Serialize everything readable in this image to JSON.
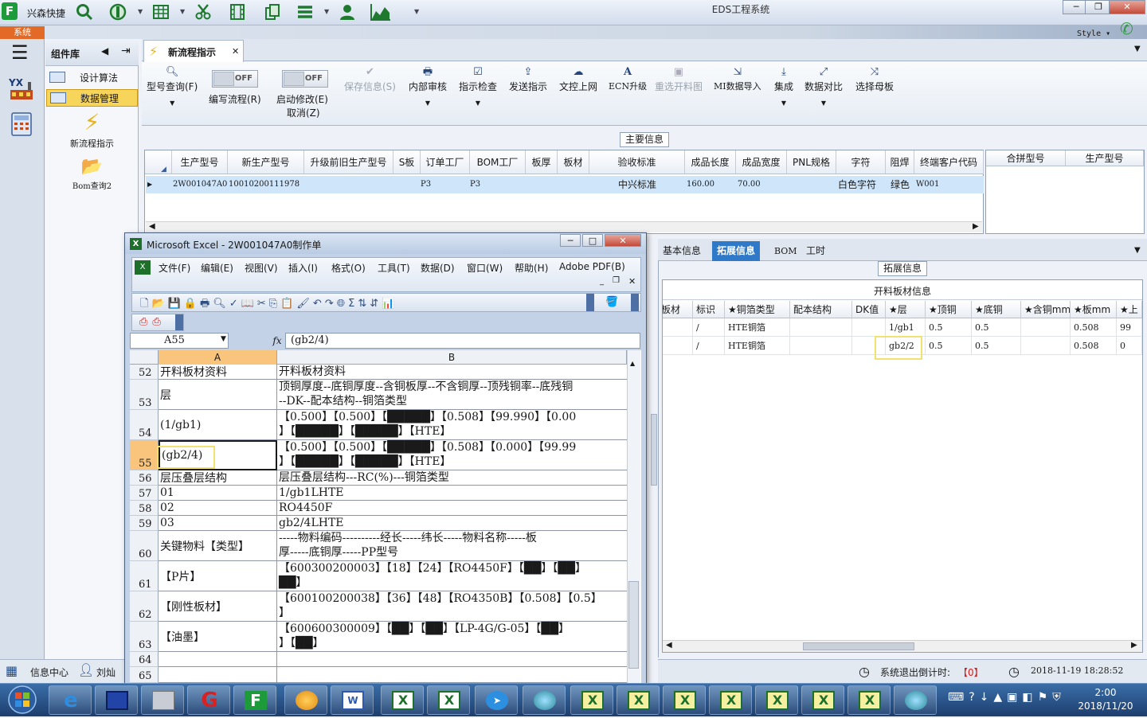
{
  "app": {
    "name": "兴森快捷",
    "window_title": "EDS工程系统",
    "system_tab": "系统",
    "style_label": "Style"
  },
  "library": {
    "title": "组件库",
    "items": [
      "设计算法",
      "数据管理"
    ],
    "big_items": [
      "新流程指示",
      "Bom查询2"
    ]
  },
  "document_tab": "新流程指示",
  "ribbon": {
    "buttons": [
      {
        "label": "型号查询(F)",
        "disabled": false
      },
      {
        "label": "编写流程(R)",
        "disabled": false,
        "toggle": "OFF"
      },
      {
        "label": "启动修改(E)",
        "sub": "取消(Z)",
        "disabled": false,
        "toggle": "OFF"
      },
      {
        "label": "保存信息(S)",
        "disabled": true
      },
      {
        "label": "内部审核",
        "disabled": false
      },
      {
        "label": "指示检查",
        "disabled": false
      },
      {
        "label": "发送指示",
        "disabled": false
      },
      {
        "label": "文控上网",
        "disabled": false
      },
      {
        "label": "ECN升级",
        "disabled": false
      },
      {
        "label": "重选开料图",
        "disabled": true
      },
      {
        "label": "MI数据导入",
        "disabled": false
      },
      {
        "label": "集成",
        "disabled": false
      },
      {
        "label": "数据对比",
        "disabled": false
      },
      {
        "label": "选择母板",
        "disabled": false
      }
    ]
  },
  "main_info": {
    "caption": "主要信息",
    "columns": [
      "生产型号",
      "新生产型号",
      "升级前旧生产型号",
      "S板",
      "订单工厂",
      "BOM工厂",
      "板厚",
      "板材",
      "验收标准",
      "成品长度",
      "成品宽度",
      "PNL规格",
      "字符",
      "阻焊",
      "终端客户代码"
    ],
    "row": [
      "2W001047A0",
      "10010200111978",
      "",
      "",
      "P3",
      "P3",
      "",
      "",
      "中兴标准",
      "160.00",
      "70.00",
      "",
      "白色字符",
      "绿色",
      "W001"
    ],
    "side_columns": [
      "合拼型号",
      "生产型号"
    ]
  },
  "right_panel": {
    "tabs": [
      "基本信息",
      "拓展信息",
      "BOM",
      "工时"
    ],
    "active_tab": "拓展信息",
    "caption": "拓展信息",
    "grid_title": "开料板材信息",
    "columns": [
      "板材",
      "标识",
      "★铜箔类型",
      "配本结构",
      "DK值",
      "★层",
      "★顶铜",
      "★底铜",
      "★含铜mm",
      "★板mm",
      "★上"
    ],
    "rows": [
      [
        "",
        "/",
        "HTE铜箔",
        "",
        "",
        "1/gb1",
        "0.5",
        "0.5",
        "",
        "0.508",
        "99"
      ],
      [
        "",
        "/",
        "HTE铜箔",
        "",
        "",
        "gb2/2",
        "0.5",
        "0.5",
        "",
        "0.508",
        "0"
      ]
    ]
  },
  "status": {
    "countdown_label": "系统退出倒计时:",
    "countdown_value": "【0】",
    "datetime": "2018-11-19 18:28:52"
  },
  "info_bar": {
    "info_center": "信息中心",
    "user": "刘灿"
  },
  "excel": {
    "title": "Microsoft Excel - 2W001047A0制作单",
    "menu": [
      "文件(F)",
      "编辑(E)",
      "视图(V)",
      "插入(I)",
      "格式(O)",
      "工具(T)",
      "数据(D)",
      "窗口(W)",
      "帮助(H)",
      "Adobe PDF(B)"
    ],
    "name_box": "A55",
    "fx": "fx",
    "formula": "(gb2/4)",
    "col_headers": [
      "A",
      "B"
    ],
    "rows": [
      {
        "n": "52",
        "a": "开料板材资料",
        "b": "开料板材资料"
      },
      {
        "n": "53",
        "a": "层",
        "b": "顶铜厚度--底铜厚度--含铜板厚--不含铜厚--顶残铜率--底残铜\n--DK--配本结构--铜箔类型"
      },
      {
        "n": "54",
        "a": "(1/gb1)",
        "b": "【0.500】【0.500】【█████】【0.508】【99.990】【0.00\n】【█████】【█████】【HTE】"
      },
      {
        "n": "55",
        "a": "(gb2/4)",
        "b": "【0.500】【0.500】【█████】【0.508】【0.000】【99.99\n】【█████】【█████】【HTE】"
      },
      {
        "n": "56",
        "a": "层压叠层结构",
        "b": "层压叠层结构---RC(%)---铜箔类型"
      },
      {
        "n": "57",
        "a": "01",
        "b": "1/gb1LHTE"
      },
      {
        "n": "58",
        "a": "02",
        "b": "RO4450F"
      },
      {
        "n": "59",
        "a": "03",
        "b": "gb2/4LHTE"
      },
      {
        "n": "60",
        "a": "关键物料【类型】",
        "b": "-----物料编码----------经长-----纬长-----物料名称-----板\n厚-----底铜厚-----PP型号"
      },
      {
        "n": "61",
        "a": "【P片】",
        "b": "【600300200003】【18】【24】【RO4450F】【██】【██】\n██】"
      },
      {
        "n": "62",
        "a": "【刚性板材】",
        "b": "【600100200038】【36】【48】【RO4350B】【0.508】【0.5】\n】"
      },
      {
        "n": "63",
        "a": "【油墨】",
        "b": "【600600300009】【██】【██】【LP-4G/G-05】【██】\n】【██】"
      },
      {
        "n": "64",
        "a": "",
        "b": ""
      },
      {
        "n": "65",
        "a": "",
        "b": ""
      }
    ]
  },
  "taskbar": {
    "time": "2:00",
    "date": "2018/11/20"
  }
}
